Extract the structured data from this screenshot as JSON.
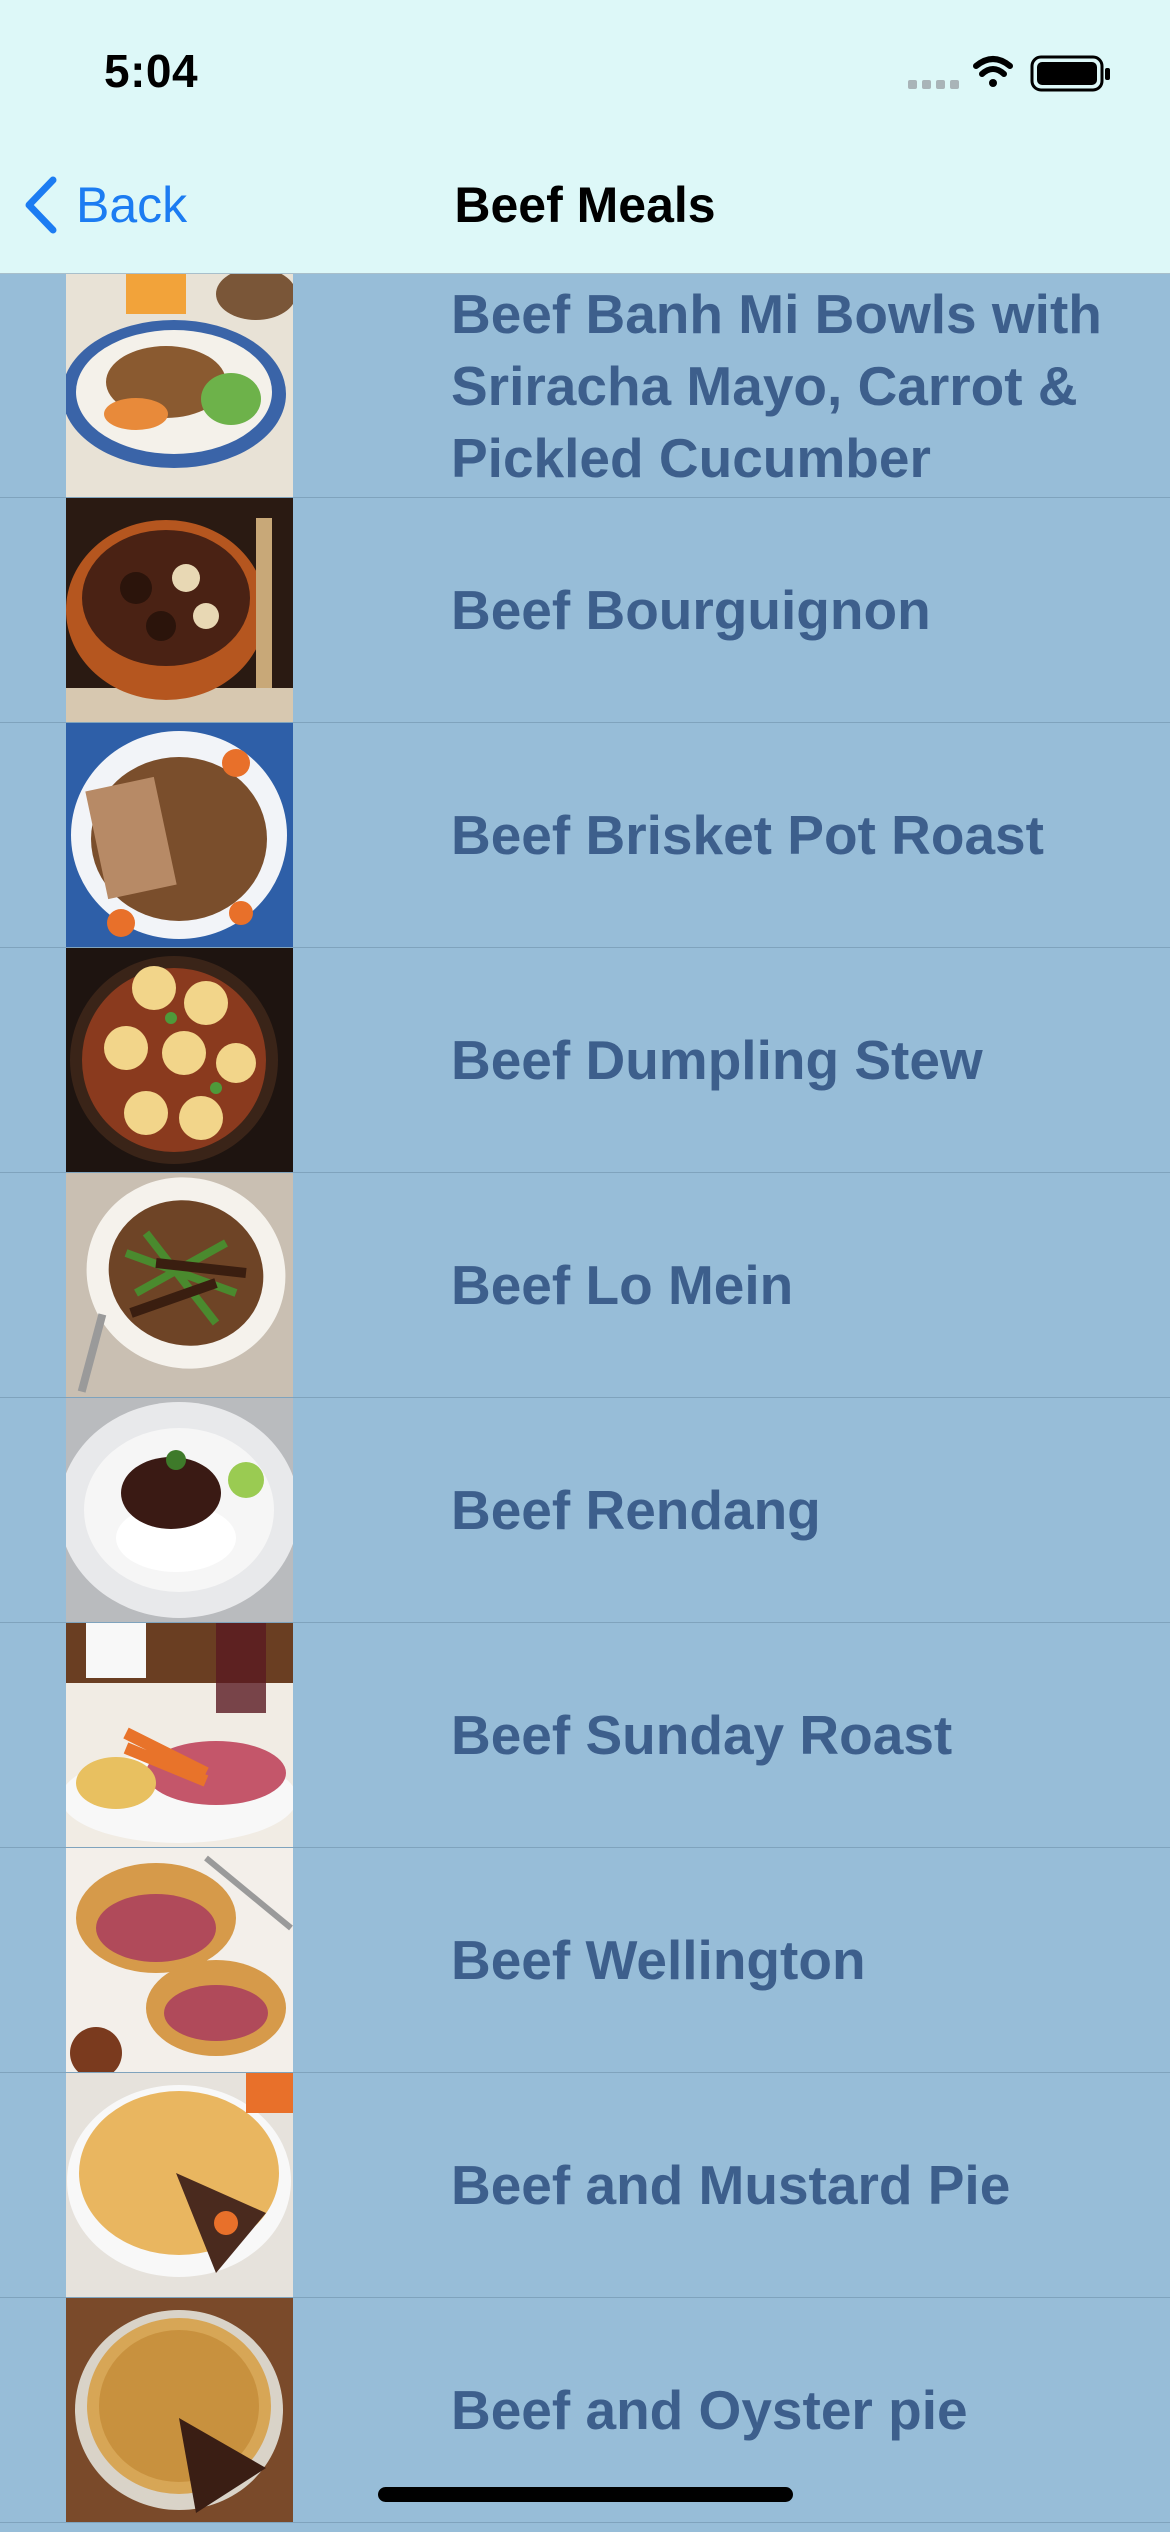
{
  "status_bar": {
    "time": "5:04",
    "icons": [
      "cellular-signal-icon",
      "wifi-icon",
      "battery-icon"
    ]
  },
  "nav": {
    "back_label": "Back",
    "title": "Beef Meals",
    "accent_color": "#1C7CF2"
  },
  "meals": [
    {
      "name": "Beef Banh Mi Bowls with Sriracha Mayo, Carrot & Pickled Cucumber"
    },
    {
      "name": "Beef Bourguignon"
    },
    {
      "name": "Beef Brisket Pot Roast"
    },
    {
      "name": "Beef Dumpling Stew"
    },
    {
      "name": "Beef Lo Mein"
    },
    {
      "name": "Beef Rendang"
    },
    {
      "name": "Beef Sunday Roast"
    },
    {
      "name": "Beef Wellington"
    },
    {
      "name": "Beef and Mustard Pie"
    },
    {
      "name": "Beef and Oyster pie"
    }
  ],
  "colors": {
    "list_background": "#97BDD8",
    "header_background": "#DDF8F8",
    "row_text": "#3D5F8C"
  }
}
